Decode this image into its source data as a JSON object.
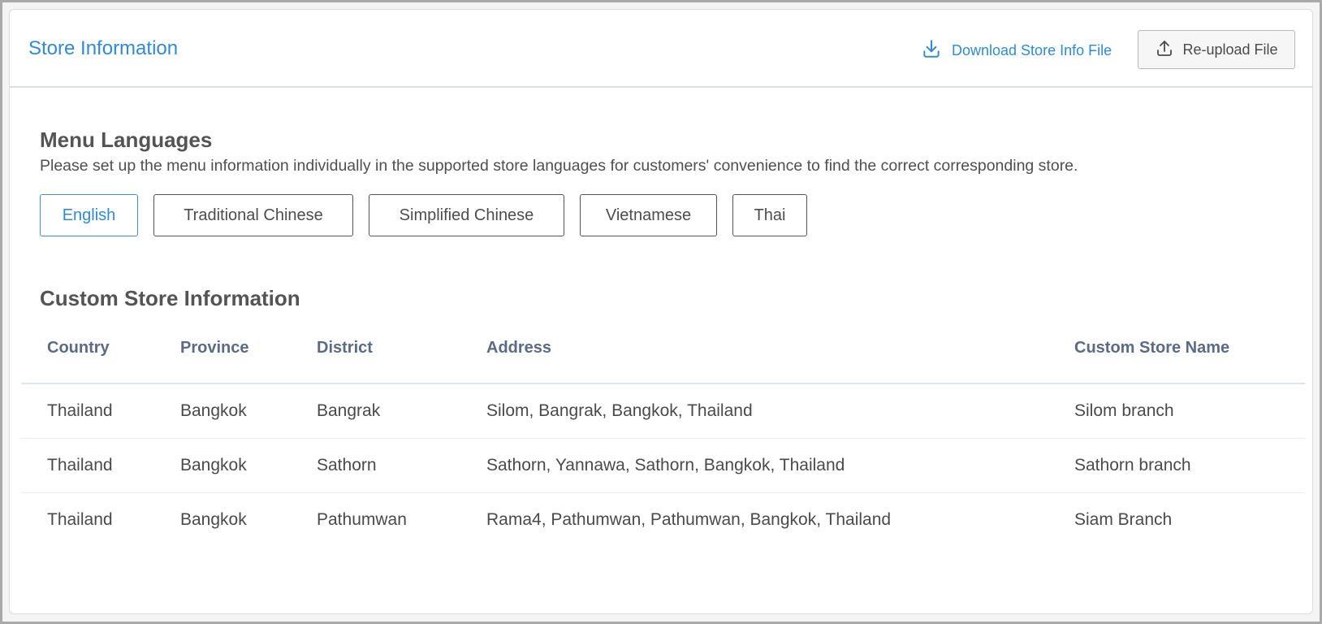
{
  "header": {
    "title": "Store Information",
    "download_label": "Download Store Info File",
    "reupload_label": "Re-upload File"
  },
  "menu_languages": {
    "title": "Menu Languages",
    "description": "Please set up the menu information individually in the supported store languages for customers' convenience to find the correct corresponding store.",
    "languages": [
      {
        "label": "English",
        "active": true
      },
      {
        "label": "Traditional Chinese",
        "active": false
      },
      {
        "label": "Simplified Chinese",
        "active": false
      },
      {
        "label": "Vietnamese",
        "active": false
      },
      {
        "label": "Thai",
        "active": false
      }
    ]
  },
  "custom_store": {
    "title": "Custom Store Information",
    "columns": [
      "Country",
      "Province",
      "District",
      "Address",
      "Custom Store Name"
    ],
    "rows": [
      [
        "Thailand",
        "Bangkok",
        "Bangrak",
        "Silom, Bangrak, Bangkok, Thailand",
        "Silom branch"
      ],
      [
        "Thailand",
        "Bangkok",
        "Sathorn",
        "Sathorn, Yannawa, Sathorn, Bangkok, Thailand",
        "Sathorn branch"
      ],
      [
        "Thailand",
        "Bangkok",
        "Pathumwan",
        "Rama4, Pathumwan, Pathumwan, Bangkok, Thailand",
        "Siam Branch"
      ]
    ]
  },
  "colors": {
    "accent": "#2f8ad8",
    "header_text": "#5b6a85"
  }
}
